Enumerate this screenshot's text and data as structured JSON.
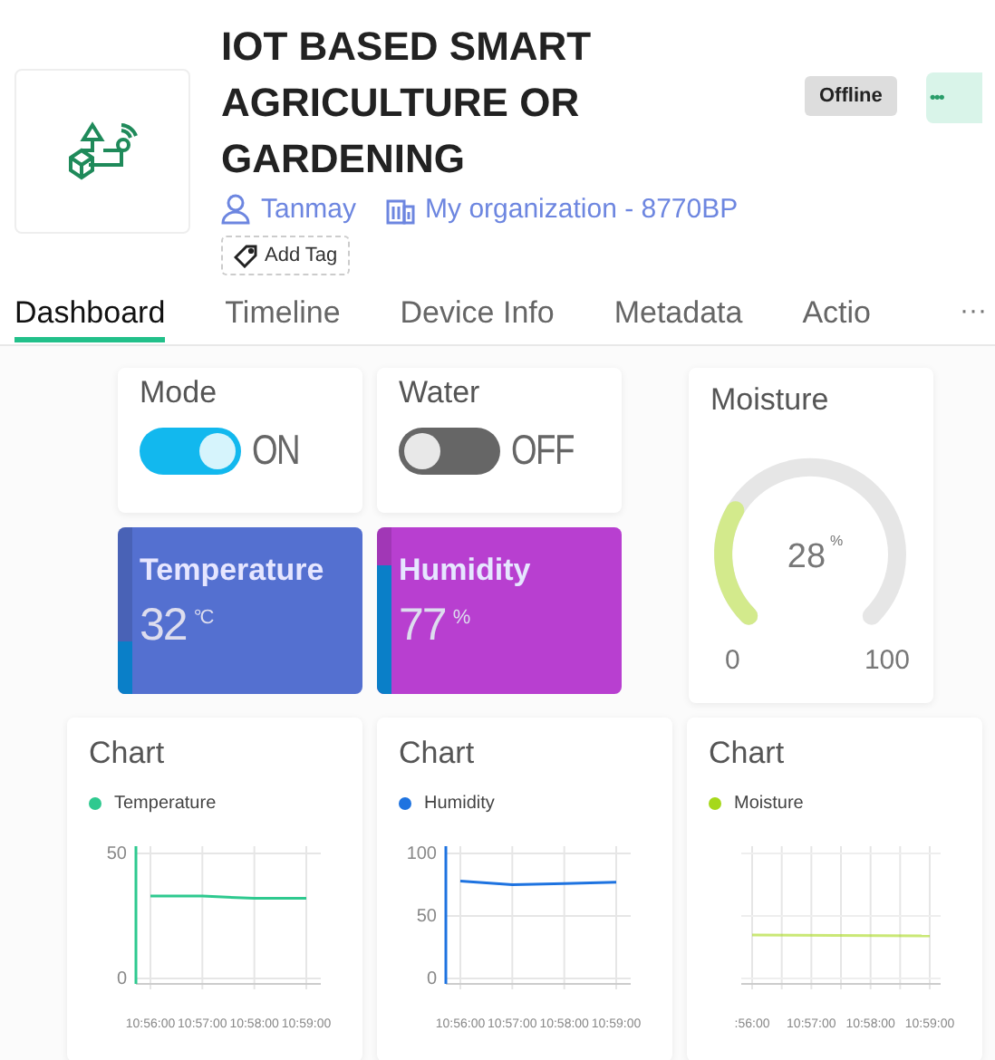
{
  "device": {
    "title": "IOT BASED SMART AGRICULTURE OR GARDENING",
    "owner": "Tanmay",
    "organization": "My organization - 8770BP",
    "add_tag": "Add Tag",
    "status": "Offline",
    "more": "•••"
  },
  "tabs": [
    {
      "label": "Dashboard",
      "selected": true
    },
    {
      "label": "Timeline",
      "selected": false
    },
    {
      "label": "Device Info",
      "selected": false
    },
    {
      "label": "Metadata",
      "selected": false
    },
    {
      "label": "Actio",
      "selected": false
    }
  ],
  "tabs_more": "···",
  "switches": [
    {
      "title": "Mode",
      "on": true,
      "label": "ON"
    },
    {
      "title": "Water",
      "on": false,
      "label": "OFF"
    }
  ],
  "tiles": [
    {
      "title": "Temperature",
      "value": "32",
      "unit": "°C",
      "color": "#5470d0",
      "level": 0.32
    },
    {
      "title": "Humidity",
      "value": "77",
      "unit": "%",
      "color": "#b83fd0",
      "level": 0.77
    }
  ],
  "gauge": {
    "title": "Moisture",
    "value": "28",
    "unit": "%",
    "min": "0",
    "max": "100"
  },
  "charts": [
    {
      "title": "Chart",
      "chart_data": {
        "type": "line",
        "categories": [
          "10:56:00",
          "10:57:00",
          "10:58:00",
          "10:59:00"
        ],
        "series": [
          {
            "name": "Temperature",
            "color": "#2ec98f",
            "values": [
              33,
              33,
              32,
              32
            ]
          }
        ],
        "ylim": [
          0,
          50
        ],
        "yticks": [
          0,
          50
        ],
        "grid": true
      }
    },
    {
      "title": "Chart",
      "chart_data": {
        "type": "line",
        "categories": [
          "10:56:00",
          "10:57:00",
          "10:58:00",
          "10:59:00"
        ],
        "series": [
          {
            "name": "Humidity",
            "color": "#1e73e0",
            "values": [
              78,
              75,
              76,
              77
            ]
          }
        ],
        "ylim": [
          0,
          100
        ],
        "yticks": [
          0,
          50,
          100
        ],
        "grid": true
      }
    },
    {
      "title": "Chart",
      "legend": "Moisture",
      "color": "#a6d81a",
      "time_labels": [
        ":56:00",
        "10:57:00",
        "10:58:00",
        "10:59:00"
      ]
    }
  ]
}
